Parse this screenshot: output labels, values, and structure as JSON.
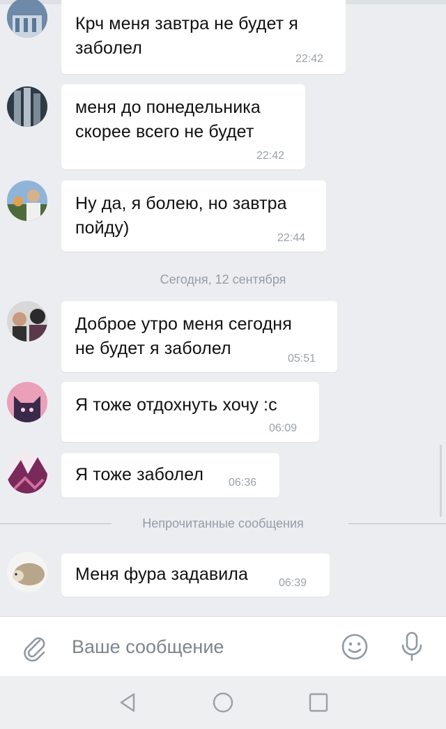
{
  "messages": [
    {
      "text": "Крч меня завтра не будет я\nзаболел",
      "time": "22:42"
    },
    {
      "text": "меня до понедельника\nскорее всего не будет",
      "time": "22:42"
    },
    {
      "text": "Ну да, я болею, но завтра\nпойду)",
      "time": "22:44"
    },
    {
      "text": "Доброе утро меня сегодня\nне будет я заболел",
      "time": "05:51"
    },
    {
      "text": "Я тоже отдохнуть хочу :с",
      "time": "06:09"
    },
    {
      "text": "Я тоже заболел",
      "time": "06:36"
    },
    {
      "text": "Меня фура задавила",
      "time": "06:39"
    }
  ],
  "date_separator": "Сегодня, 12 сентября",
  "unread_separator": "Непрочитанные сообщения",
  "input": {
    "placeholder": "Ваше сообщение"
  },
  "icons": {
    "attach": "paperclip-icon",
    "emoji": "smiley-icon",
    "mic": "microphone-icon",
    "back": "nav-back-icon",
    "home": "nav-home-icon",
    "recents": "nav-recents-icon"
  },
  "colors": {
    "background": "#ebedf0",
    "bubble": "#ffffff",
    "time": "#9aa1a8",
    "icon": "#8f99a3"
  }
}
